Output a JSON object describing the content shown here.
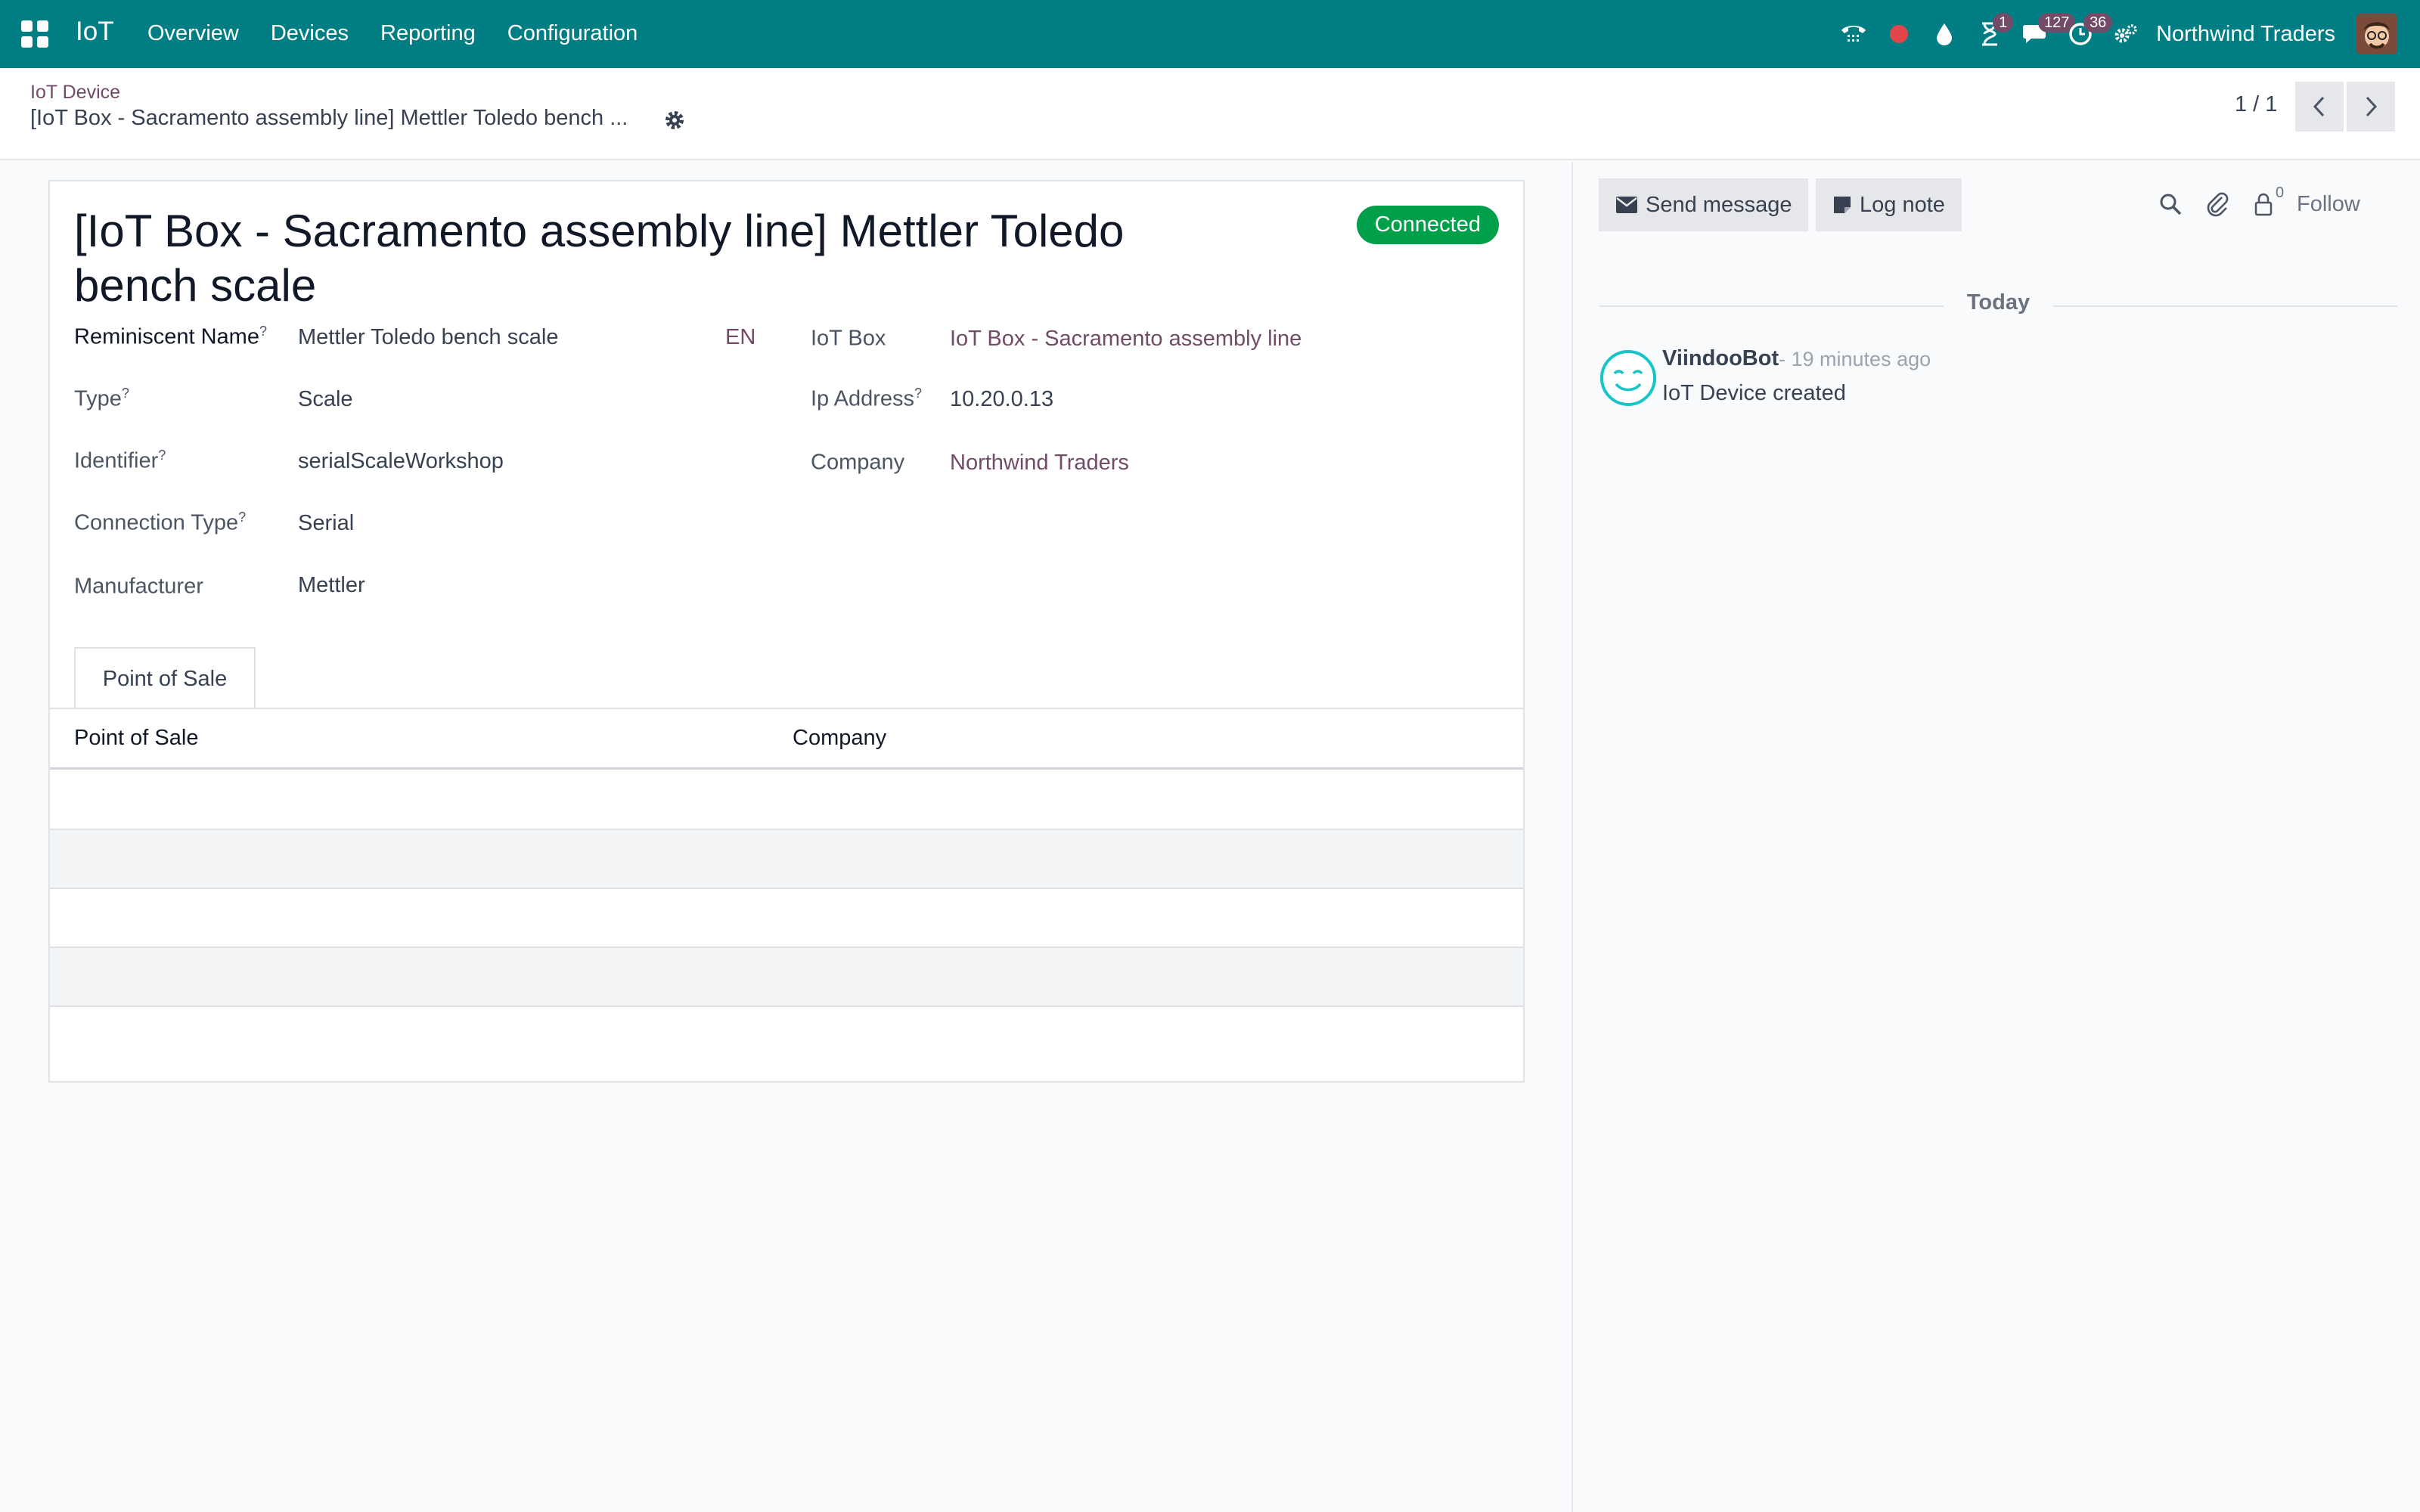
{
  "navbar": {
    "app_name": "IoT",
    "menu": [
      "Overview",
      "Devices",
      "Reporting",
      "Configuration"
    ],
    "badges": {
      "activity_clock": "1",
      "messages": "127",
      "activities": "36"
    },
    "company": "Northwind Traders"
  },
  "control_panel": {
    "breadcrumb_parent": "IoT Device",
    "breadcrumb_current": "[IoT Box - Sacramento assembly line] Mettler Toledo bench ...",
    "pager": "1 / 1"
  },
  "form": {
    "title": "[IoT Box - Sacramento assembly line] Mettler Toledo bench scale",
    "status": "Connected",
    "left_fields": [
      {
        "label": "Reminiscent Name",
        "help": "?",
        "value": "Mettler Toledo bench scale"
      },
      {
        "label": "Type",
        "help": "?",
        "value": "Scale"
      },
      {
        "label": "Identifier",
        "help": "?",
        "value": "serialScaleWorkshop"
      },
      {
        "label": "Connection Type",
        "help": "?",
        "value": "Serial"
      },
      {
        "label": "Manufacturer",
        "help": "",
        "value": "Mettler"
      }
    ],
    "lang": "EN",
    "right_fields": [
      {
        "label": "IoT Box",
        "help": "",
        "value": "IoT Box - Sacramento assembly line"
      },
      {
        "label": "Ip Address",
        "help": "?",
        "value": "10.20.0.13"
      },
      {
        "label": "Company",
        "help": "",
        "value": "Northwind Traders"
      }
    ],
    "tab": "Point of Sale",
    "table_headers": [
      "Point of Sale",
      "Company"
    ]
  },
  "chatter": {
    "send_message": "Send message",
    "log_note": "Log note",
    "followers_count": "0",
    "follow": "Follow",
    "date_separator": "Today",
    "message": {
      "author": "ViindooBot",
      "time": "- 19 minutes ago",
      "body": "IoT Device created"
    }
  },
  "colors": {
    "navbar": "#017e84",
    "link": "#714b67",
    "status": "#00a04a"
  }
}
